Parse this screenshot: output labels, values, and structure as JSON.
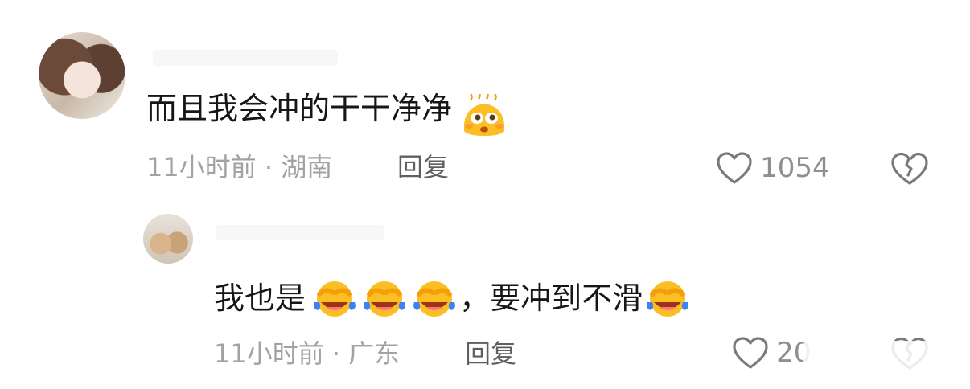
{
  "comment": {
    "text": "而且我会冲的干干净净",
    "emoji": "sweating-hot-face-emoji",
    "time_location": "11小时前 · 湖南",
    "reply_label": "回复",
    "like_count": "1054",
    "like_icon": "heart-outline-icon",
    "dislike_icon": "broken-heart-icon"
  },
  "reply": {
    "text_part1": "我也是",
    "text_part2": "，要冲到不滑",
    "emoji": "laughing-crying-emoji",
    "time_location": "11小时前 · 广东",
    "reply_label": "回复",
    "like_count": "20",
    "like_icon": "heart-outline-icon",
    "dislike_icon": "broken-heart-icon"
  },
  "colors": {
    "text": "#161616",
    "meta": "#a2a2a2",
    "icon": "#7a7a7a",
    "emoji_yellow": "#fbbf24"
  }
}
